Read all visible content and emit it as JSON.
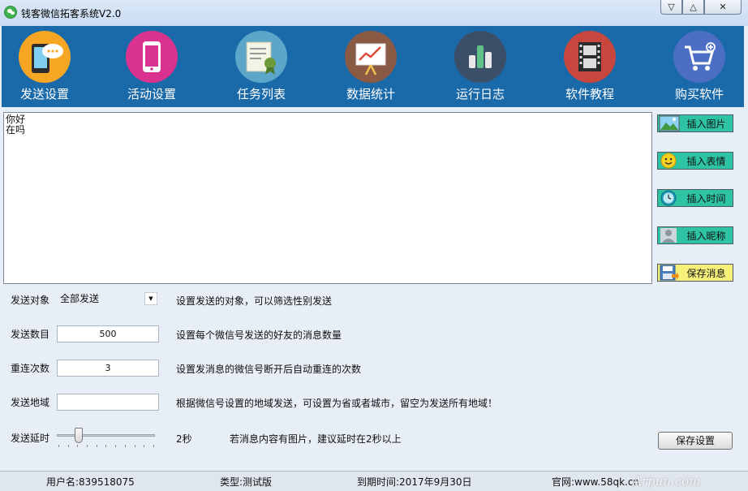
{
  "window": {
    "title": "钱客微信拓客系统V2.0",
    "controls": [
      "minimize",
      "maximize",
      "close"
    ]
  },
  "toolbar": {
    "items": [
      {
        "label": "发送设置",
        "icon": "phone-chat-icon",
        "color": "#f5a623"
      },
      {
        "label": "活动设置",
        "icon": "mobile-phone-icon",
        "color": "#d9338f"
      },
      {
        "label": "任务列表",
        "icon": "certificate-icon",
        "color": "#5ba6c9"
      },
      {
        "label": "数据统计",
        "icon": "chart-board-icon",
        "color": "#8b5a45"
      },
      {
        "label": "运行日志",
        "icon": "bar-chart-icon",
        "color": "#3b4f68"
      },
      {
        "label": "软件教程",
        "icon": "film-icon",
        "color": "#c9463f"
      },
      {
        "label": "购买软件",
        "icon": "shopping-cart-icon",
        "color": "#4c6fc4"
      }
    ]
  },
  "message": {
    "text": "你好\n在吗"
  },
  "side_buttons": [
    {
      "label": "插入图片",
      "icon": "picture-icon",
      "bg": "#2ec3a3"
    },
    {
      "label": "插入表情",
      "icon": "smiley-icon",
      "bg": "#2ec3a3"
    },
    {
      "label": "插入时间",
      "icon": "clock-icon",
      "bg": "#2ec3a3"
    },
    {
      "label": "插入昵称",
      "icon": "user-icon",
      "bg": "#2ec3a3"
    },
    {
      "label": "保存消息",
      "icon": "save-icon",
      "bg": "#f5f07a"
    }
  ],
  "form": {
    "target": {
      "label": "发送对象",
      "value": "全部发送",
      "desc": "设置发送的对象，可以筛选性别发送"
    },
    "count": {
      "label": "发送数目",
      "value": "500",
      "desc": "设置每个微信号发送的好友的消息数量"
    },
    "retry": {
      "label": "重连次数",
      "value": "3",
      "desc": "设置发消息的微信号断开后自动重连的次数"
    },
    "region": {
      "label": "发送地域",
      "value": "",
      "desc": "根据微信号设置的地域发送，可设置为省或者城市，留空为发送所有地域！"
    },
    "delay": {
      "label": "发送延时",
      "value_text": "2秒",
      "desc": "若消息内容有图片，建议延时在2秒以上",
      "slider_fraction": 0.2
    }
  },
  "save_settings_label": "保存设置",
  "status": {
    "username": "用户名:839518075",
    "type": "类型:测试版",
    "expiry": "到期时间:2017年9月30日",
    "site": "官网:www.58qk.cn"
  },
  "watermark": "Arpun.com"
}
